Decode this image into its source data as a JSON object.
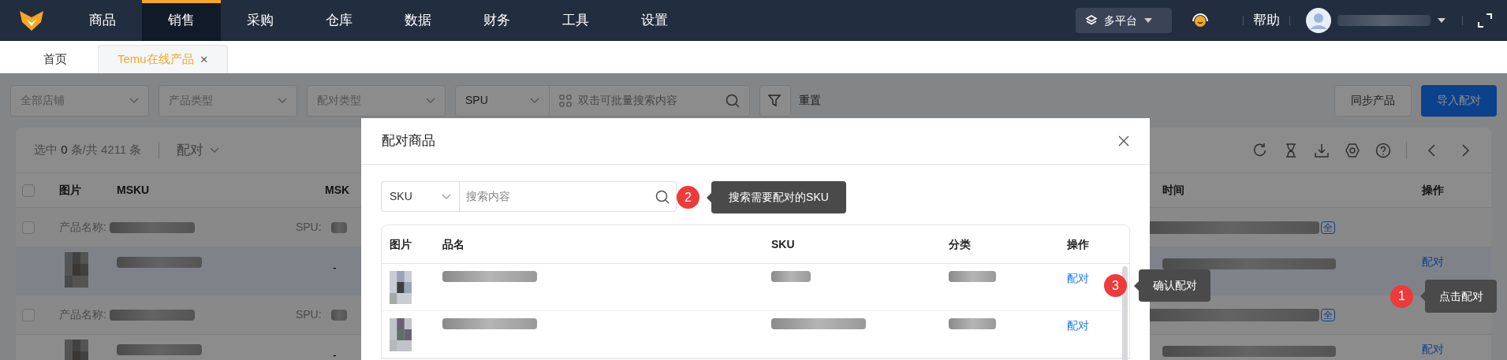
{
  "nav": {
    "items": [
      {
        "label": "商品",
        "selected": false
      },
      {
        "label": "销售",
        "selected": true
      },
      {
        "label": "采购",
        "selected": false
      },
      {
        "label": "仓库",
        "selected": false
      },
      {
        "label": "数据",
        "selected": false
      },
      {
        "label": "财务",
        "selected": false
      },
      {
        "label": "工具",
        "selected": false
      },
      {
        "label": "设置",
        "selected": false
      }
    ],
    "platform": "多平台",
    "help": "帮助"
  },
  "tabs": [
    {
      "label": "首页",
      "selected": false,
      "closable": false
    },
    {
      "label": "Temu在线产品",
      "selected": true,
      "closable": true,
      "close": "×"
    }
  ],
  "filters": {
    "selects": [
      "全部店铺",
      "产品类型",
      "配对类型"
    ],
    "search_type": "SPU",
    "search_placeholder": "双击可批量搜索内容",
    "reset": "重置",
    "buttons": [
      {
        "label": "同步产品",
        "primary": false
      },
      {
        "label": "导入配对",
        "primary": true
      }
    ]
  },
  "table": {
    "selection_text": "选中 **0** 条/共 4211 条",
    "bulk_action": "配对",
    "all_checked": false,
    "columns": [
      "图片",
      "MSKU",
      "MSK",
      "时间",
      "操作"
    ],
    "rows": [
      {
        "kind": "group",
        "checked": false,
        "name_label": "产品名称:",
        "spu_label": "SPU:",
        "badge": "全"
      },
      {
        "kind": "item",
        "selected": true,
        "msku2": "-",
        "action": "配对"
      },
      {
        "kind": "group",
        "checked": false,
        "name_label": "产品名称:",
        "spu_label": "SPU:",
        "badge": "全"
      },
      {
        "kind": "item",
        "selected": false,
        "msku2": "-",
        "action": "配对"
      }
    ]
  },
  "modal": {
    "title": "配对商品",
    "search_type": "SKU",
    "search_placeholder": "搜索内容",
    "columns": [
      "图片",
      "品名",
      "SKU",
      "分类",
      "操作"
    ],
    "rows": [
      {
        "action": "配对"
      },
      {
        "action": "配对"
      }
    ]
  },
  "annotations": [
    {
      "number": "2",
      "text": "搜索需要配对的SKU"
    },
    {
      "number": "3",
      "text": "确认配对"
    },
    {
      "number": "1",
      "text": "点击配对"
    }
  ]
}
